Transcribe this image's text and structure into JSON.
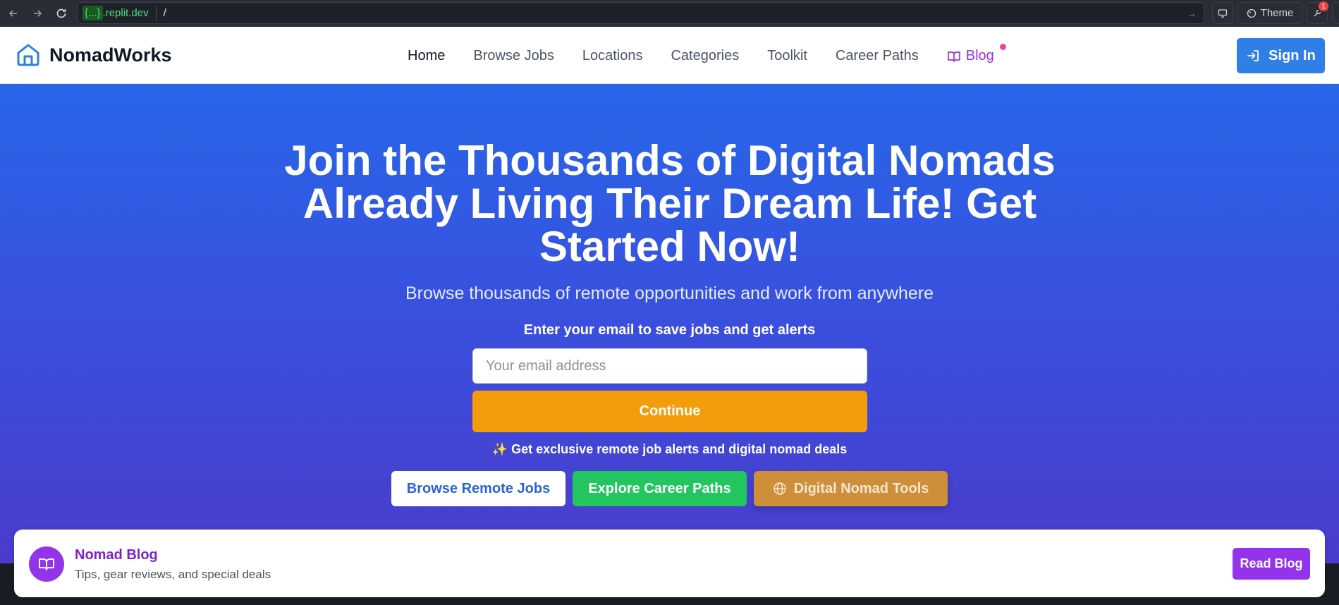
{
  "browser": {
    "url_host": "{...}",
    "url_domain": ".replit.dev",
    "url_path": "/",
    "theme_label": "Theme",
    "notification_count": "1"
  },
  "header": {
    "brand": "NomadWorks",
    "nav": [
      {
        "label": "Home"
      },
      {
        "label": "Browse Jobs"
      },
      {
        "label": "Locations"
      },
      {
        "label": "Categories"
      },
      {
        "label": "Toolkit"
      },
      {
        "label": "Career Paths"
      },
      {
        "label": "Blog"
      }
    ],
    "signin_label": "Sign In"
  },
  "hero": {
    "title": "Join the Thousands of Digital Nomads Already Living Their Dream Life! Get Started Now!",
    "subtitle": "Browse thousands of remote opportunities and work from anywhere",
    "email_label": "Enter your email to save jobs and get alerts",
    "email_placeholder": "Your email address",
    "continue_label": "Continue",
    "alerts_note": "✨ Get exclusive remote job alerts and digital nomad deals",
    "buttons": {
      "browse": "Browse Remote Jobs",
      "paths": "Explore Career Paths",
      "tools": "Digital Nomad Tools"
    }
  },
  "blog_banner": {
    "title": "Nomad Blog",
    "subtitle": "Tips, gear reviews, and special deals",
    "button": "Read Blog"
  },
  "colors": {
    "primary": "#2f7fe6",
    "accent": "#f39c0c",
    "success": "#22c55e",
    "blog": "#9333ea"
  }
}
